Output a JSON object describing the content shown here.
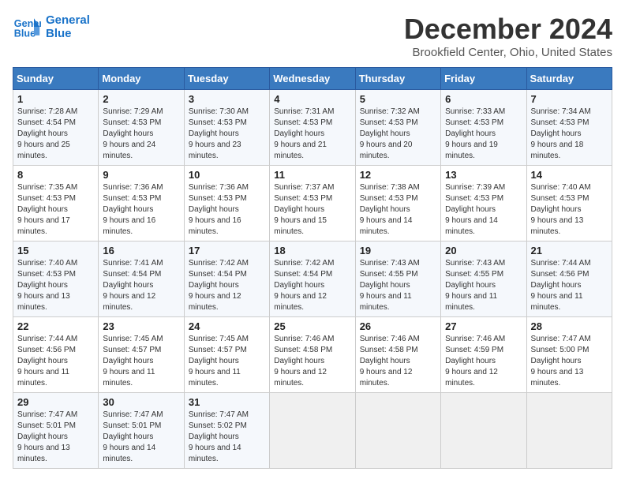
{
  "header": {
    "logo_line1": "General",
    "logo_line2": "Blue",
    "month_year": "December 2024",
    "location": "Brookfield Center, Ohio, United States"
  },
  "weekdays": [
    "Sunday",
    "Monday",
    "Tuesday",
    "Wednesday",
    "Thursday",
    "Friday",
    "Saturday"
  ],
  "weeks": [
    [
      {
        "day": "1",
        "sunrise": "7:28 AM",
        "sunset": "4:54 PM",
        "daylight": "9 hours and 25 minutes."
      },
      {
        "day": "2",
        "sunrise": "7:29 AM",
        "sunset": "4:53 PM",
        "daylight": "9 hours and 24 minutes."
      },
      {
        "day": "3",
        "sunrise": "7:30 AM",
        "sunset": "4:53 PM",
        "daylight": "9 hours and 23 minutes."
      },
      {
        "day": "4",
        "sunrise": "7:31 AM",
        "sunset": "4:53 PM",
        "daylight": "9 hours and 21 minutes."
      },
      {
        "day": "5",
        "sunrise": "7:32 AM",
        "sunset": "4:53 PM",
        "daylight": "9 hours and 20 minutes."
      },
      {
        "day": "6",
        "sunrise": "7:33 AM",
        "sunset": "4:53 PM",
        "daylight": "9 hours and 19 minutes."
      },
      {
        "day": "7",
        "sunrise": "7:34 AM",
        "sunset": "4:53 PM",
        "daylight": "9 hours and 18 minutes."
      }
    ],
    [
      {
        "day": "8",
        "sunrise": "7:35 AM",
        "sunset": "4:53 PM",
        "daylight": "9 hours and 17 minutes."
      },
      {
        "day": "9",
        "sunrise": "7:36 AM",
        "sunset": "4:53 PM",
        "daylight": "9 hours and 16 minutes."
      },
      {
        "day": "10",
        "sunrise": "7:36 AM",
        "sunset": "4:53 PM",
        "daylight": "9 hours and 16 minutes."
      },
      {
        "day": "11",
        "sunrise": "7:37 AM",
        "sunset": "4:53 PM",
        "daylight": "9 hours and 15 minutes."
      },
      {
        "day": "12",
        "sunrise": "7:38 AM",
        "sunset": "4:53 PM",
        "daylight": "9 hours and 14 minutes."
      },
      {
        "day": "13",
        "sunrise": "7:39 AM",
        "sunset": "4:53 PM",
        "daylight": "9 hours and 14 minutes."
      },
      {
        "day": "14",
        "sunrise": "7:40 AM",
        "sunset": "4:53 PM",
        "daylight": "9 hours and 13 minutes."
      }
    ],
    [
      {
        "day": "15",
        "sunrise": "7:40 AM",
        "sunset": "4:53 PM",
        "daylight": "9 hours and 13 minutes."
      },
      {
        "day": "16",
        "sunrise": "7:41 AM",
        "sunset": "4:54 PM",
        "daylight": "9 hours and 12 minutes."
      },
      {
        "day": "17",
        "sunrise": "7:42 AM",
        "sunset": "4:54 PM",
        "daylight": "9 hours and 12 minutes."
      },
      {
        "day": "18",
        "sunrise": "7:42 AM",
        "sunset": "4:54 PM",
        "daylight": "9 hours and 12 minutes."
      },
      {
        "day": "19",
        "sunrise": "7:43 AM",
        "sunset": "4:55 PM",
        "daylight": "9 hours and 11 minutes."
      },
      {
        "day": "20",
        "sunrise": "7:43 AM",
        "sunset": "4:55 PM",
        "daylight": "9 hours and 11 minutes."
      },
      {
        "day": "21",
        "sunrise": "7:44 AM",
        "sunset": "4:56 PM",
        "daylight": "9 hours and 11 minutes."
      }
    ],
    [
      {
        "day": "22",
        "sunrise": "7:44 AM",
        "sunset": "4:56 PM",
        "daylight": "9 hours and 11 minutes."
      },
      {
        "day": "23",
        "sunrise": "7:45 AM",
        "sunset": "4:57 PM",
        "daylight": "9 hours and 11 minutes."
      },
      {
        "day": "24",
        "sunrise": "7:45 AM",
        "sunset": "4:57 PM",
        "daylight": "9 hours and 11 minutes."
      },
      {
        "day": "25",
        "sunrise": "7:46 AM",
        "sunset": "4:58 PM",
        "daylight": "9 hours and 12 minutes."
      },
      {
        "day": "26",
        "sunrise": "7:46 AM",
        "sunset": "4:58 PM",
        "daylight": "9 hours and 12 minutes."
      },
      {
        "day": "27",
        "sunrise": "7:46 AM",
        "sunset": "4:59 PM",
        "daylight": "9 hours and 12 minutes."
      },
      {
        "day": "28",
        "sunrise": "7:47 AM",
        "sunset": "5:00 PM",
        "daylight": "9 hours and 13 minutes."
      }
    ],
    [
      {
        "day": "29",
        "sunrise": "7:47 AM",
        "sunset": "5:01 PM",
        "daylight": "9 hours and 13 minutes."
      },
      {
        "day": "30",
        "sunrise": "7:47 AM",
        "sunset": "5:01 PM",
        "daylight": "9 hours and 14 minutes."
      },
      {
        "day": "31",
        "sunrise": "7:47 AM",
        "sunset": "5:02 PM",
        "daylight": "9 hours and 14 minutes."
      },
      null,
      null,
      null,
      null
    ]
  ],
  "labels": {
    "sunrise": "Sunrise:",
    "sunset": "Sunset:",
    "daylight": "Daylight hours"
  }
}
